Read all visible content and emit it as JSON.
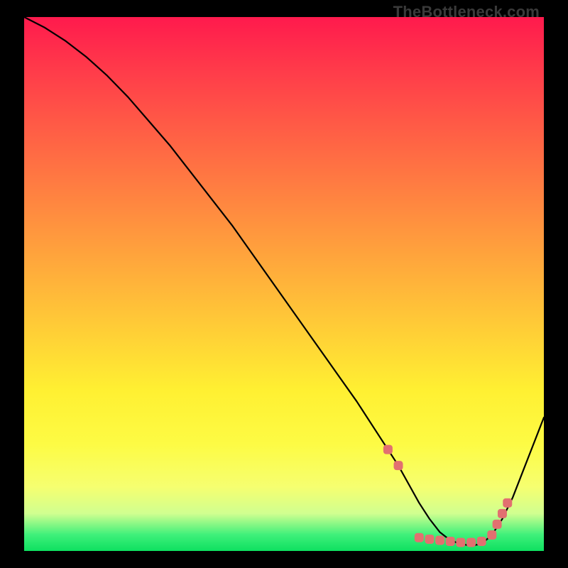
{
  "watermark": "TheBottleneck.com",
  "colors": {
    "background": "#000000",
    "curve": "#000000",
    "mark": "#e27070"
  },
  "chart_data": {
    "type": "line",
    "title": "",
    "xlabel": "",
    "ylabel": "",
    "xlim": [
      0,
      100
    ],
    "ylim": [
      0,
      100
    ],
    "grid": false,
    "series": [
      {
        "name": "bottleneck-curve",
        "x": [
          0,
          4,
          8,
          12,
          16,
          20,
          24,
          28,
          32,
          36,
          40,
          44,
          48,
          52,
          56,
          60,
          64,
          68,
          70,
          72,
          74,
          76,
          78,
          80,
          82,
          84,
          86,
          88,
          90,
          92,
          94,
          96,
          98,
          100
        ],
        "y": [
          100,
          98,
          95.5,
          92.5,
          89,
          85,
          80.5,
          76,
          71,
          66,
          61,
          55.5,
          50,
          44.5,
          39,
          33.5,
          28,
          22,
          19,
          16,
          12.5,
          9,
          6,
          3.5,
          2,
          1.3,
          1,
          1.3,
          3,
          6,
          10,
          15,
          20,
          25
        ]
      }
    ],
    "marks": {
      "name": "highlighted-range",
      "points": [
        {
          "x": 70,
          "y": 19
        },
        {
          "x": 72,
          "y": 16
        },
        {
          "x": 76,
          "y": 2.5
        },
        {
          "x": 78,
          "y": 2.2
        },
        {
          "x": 80,
          "y": 2
        },
        {
          "x": 82,
          "y": 1.8
        },
        {
          "x": 84,
          "y": 1.6
        },
        {
          "x": 86,
          "y": 1.6
        },
        {
          "x": 88,
          "y": 1.8
        },
        {
          "x": 90,
          "y": 3
        },
        {
          "x": 91,
          "y": 5
        },
        {
          "x": 92,
          "y": 7
        },
        {
          "x": 93,
          "y": 9
        }
      ]
    }
  }
}
